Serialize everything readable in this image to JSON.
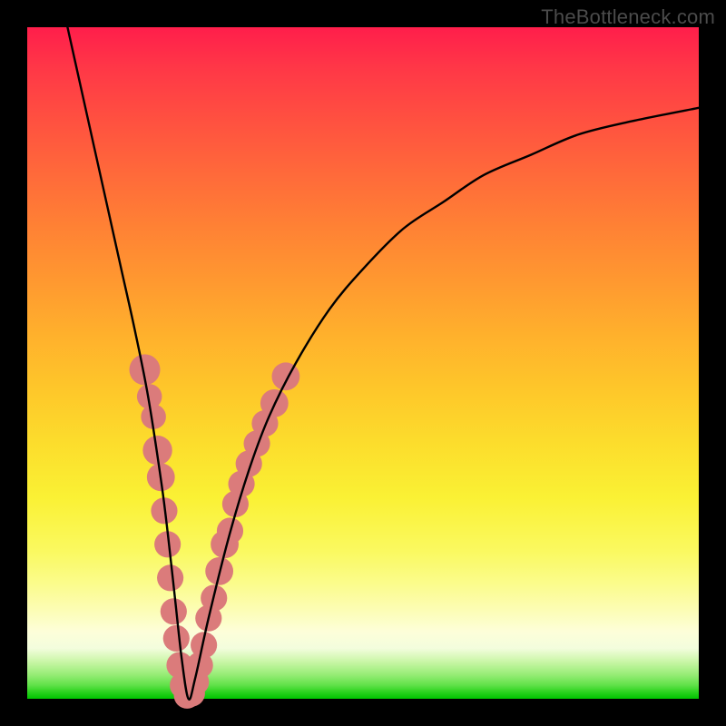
{
  "watermark": "TheBottleneck.com",
  "chart_data": {
    "type": "line",
    "title": "",
    "xlabel": "",
    "ylabel": "",
    "xlim": [
      0,
      100
    ],
    "ylim": [
      0,
      100
    ],
    "series": [
      {
        "name": "curve",
        "x": [
          6,
          8,
          10,
          12,
          14,
          16,
          18,
          20,
          21,
          22,
          23,
          24,
          25,
          27,
          30,
          33,
          36,
          40,
          45,
          50,
          56,
          62,
          68,
          75,
          82,
          90,
          100
        ],
        "values": [
          100,
          91,
          82,
          73,
          64,
          55,
          45,
          32,
          24,
          15,
          6,
          0,
          3,
          12,
          24,
          34,
          42,
          50,
          58,
          64,
          70,
          74,
          78,
          81,
          84,
          86,
          88
        ]
      }
    ],
    "markers": {
      "name": "highlight-dots",
      "color": "#db7b7b",
      "points": [
        {
          "x": 17.5,
          "y": 49,
          "r": 1.6
        },
        {
          "x": 18.2,
          "y": 45,
          "r": 1.2
        },
        {
          "x": 18.8,
          "y": 42,
          "r": 1.2
        },
        {
          "x": 19.4,
          "y": 37,
          "r": 1.5
        },
        {
          "x": 19.9,
          "y": 33,
          "r": 1.4
        },
        {
          "x": 20.4,
          "y": 28,
          "r": 1.3
        },
        {
          "x": 20.9,
          "y": 23,
          "r": 1.3
        },
        {
          "x": 21.3,
          "y": 18,
          "r": 1.3
        },
        {
          "x": 21.8,
          "y": 13,
          "r": 1.3
        },
        {
          "x": 22.2,
          "y": 9,
          "r": 1.3
        },
        {
          "x": 22.7,
          "y": 5,
          "r": 1.3
        },
        {
          "x": 23.2,
          "y": 2,
          "r": 1.3
        },
        {
          "x": 23.8,
          "y": 0.5,
          "r": 1.3
        },
        {
          "x": 24.5,
          "y": 0.8,
          "r": 1.3
        },
        {
          "x": 25.1,
          "y": 2.5,
          "r": 1.3
        },
        {
          "x": 25.7,
          "y": 5,
          "r": 1.3
        },
        {
          "x": 26.3,
          "y": 8,
          "r": 1.3
        },
        {
          "x": 27.0,
          "y": 12,
          "r": 1.3
        },
        {
          "x": 27.8,
          "y": 15,
          "r": 1.3
        },
        {
          "x": 28.6,
          "y": 19,
          "r": 1.4
        },
        {
          "x": 29.4,
          "y": 23,
          "r": 1.4
        },
        {
          "x": 30.2,
          "y": 25,
          "r": 1.3
        },
        {
          "x": 31.0,
          "y": 29,
          "r": 1.3
        },
        {
          "x": 31.9,
          "y": 32,
          "r": 1.3
        },
        {
          "x": 33.0,
          "y": 35,
          "r": 1.3
        },
        {
          "x": 34.2,
          "y": 38,
          "r": 1.3
        },
        {
          "x": 35.4,
          "y": 41,
          "r": 1.3
        },
        {
          "x": 36.8,
          "y": 44,
          "r": 1.4
        },
        {
          "x": 38.5,
          "y": 48,
          "r": 1.4
        }
      ]
    }
  }
}
